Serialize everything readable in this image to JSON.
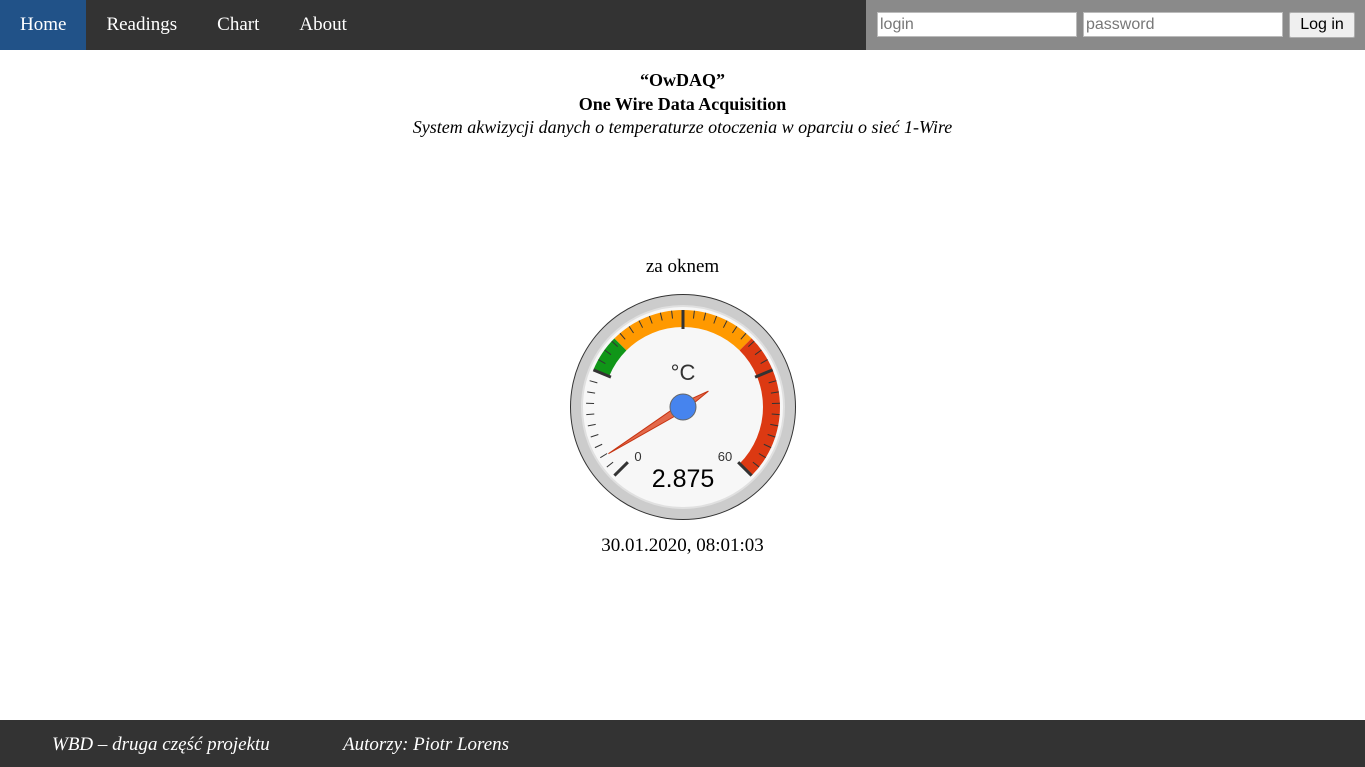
{
  "nav": {
    "items": [
      {
        "label": "Home",
        "active": true
      },
      {
        "label": "Readings",
        "active": false
      },
      {
        "label": "Chart",
        "active": false
      },
      {
        "label": "About",
        "active": false
      }
    ]
  },
  "login": {
    "login_placeholder": "login",
    "password_placeholder": "password",
    "button_label": "Log in"
  },
  "header": {
    "title": "“OwDAQ”",
    "subtitle": "One Wire Data Acquisition",
    "description": "System akwizycji danych o temperaturze otoczenia w oparciu o sieć 1-Wire"
  },
  "gauge": {
    "label": "za oknem",
    "unit": "°C",
    "min": 0,
    "max": 60,
    "min_label": "0",
    "max_label": "60",
    "value": 2.875,
    "value_text": "2.875",
    "timestamp": "30.01.2020, 08:01:03",
    "bands": [
      {
        "from": 15,
        "to": 20,
        "color": "#109618"
      },
      {
        "from": 20,
        "to": 40,
        "color": "#ff9900"
      },
      {
        "from": 40,
        "to": 60,
        "color": "#dc3912"
      }
    ],
    "major_ticks": 4,
    "minor_ticks": 9
  },
  "footer": {
    "left": "WBD – druga część projektu",
    "right": "Autorzy: Piotr Lorens"
  },
  "colors": {
    "nav_bg": "#333333",
    "nav_active": "#215288",
    "login_bg": "#8a8a8a",
    "needle": "#dc3912",
    "needle_hub": "#4684ee"
  }
}
